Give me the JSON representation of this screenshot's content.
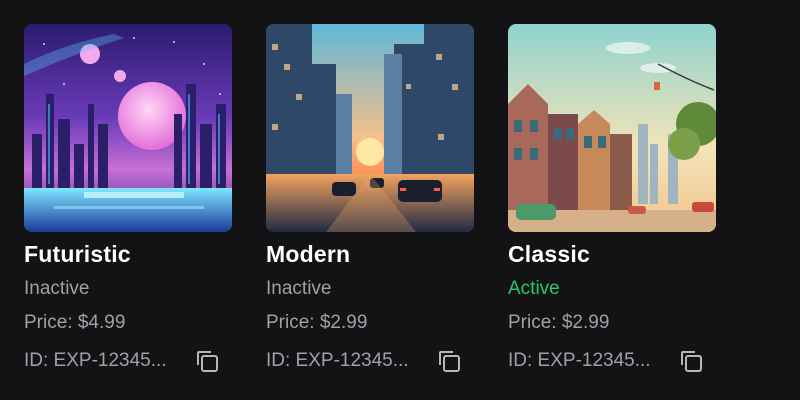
{
  "cards": [
    {
      "title": "Futuristic",
      "status": "Inactive",
      "price": "Price: $4.99",
      "id": "ID: EXP-12345...",
      "image": "futuristic-city-illustration"
    },
    {
      "title": "Modern",
      "status": "Inactive",
      "price": "Price: $2.99",
      "id": "ID: EXP-12345...",
      "image": "modern-city-street-sunset-illustration"
    },
    {
      "title": "Classic",
      "status": "Active",
      "price": "Price: $2.99",
      "id": "ID: EXP-12345...",
      "image": "classic-town-street-illustration"
    }
  ],
  "icons": {
    "copy": "copy-icon"
  },
  "colors": {
    "background": "#131315",
    "muted_text": "#a0a0a6",
    "active": "#2bc76a"
  }
}
